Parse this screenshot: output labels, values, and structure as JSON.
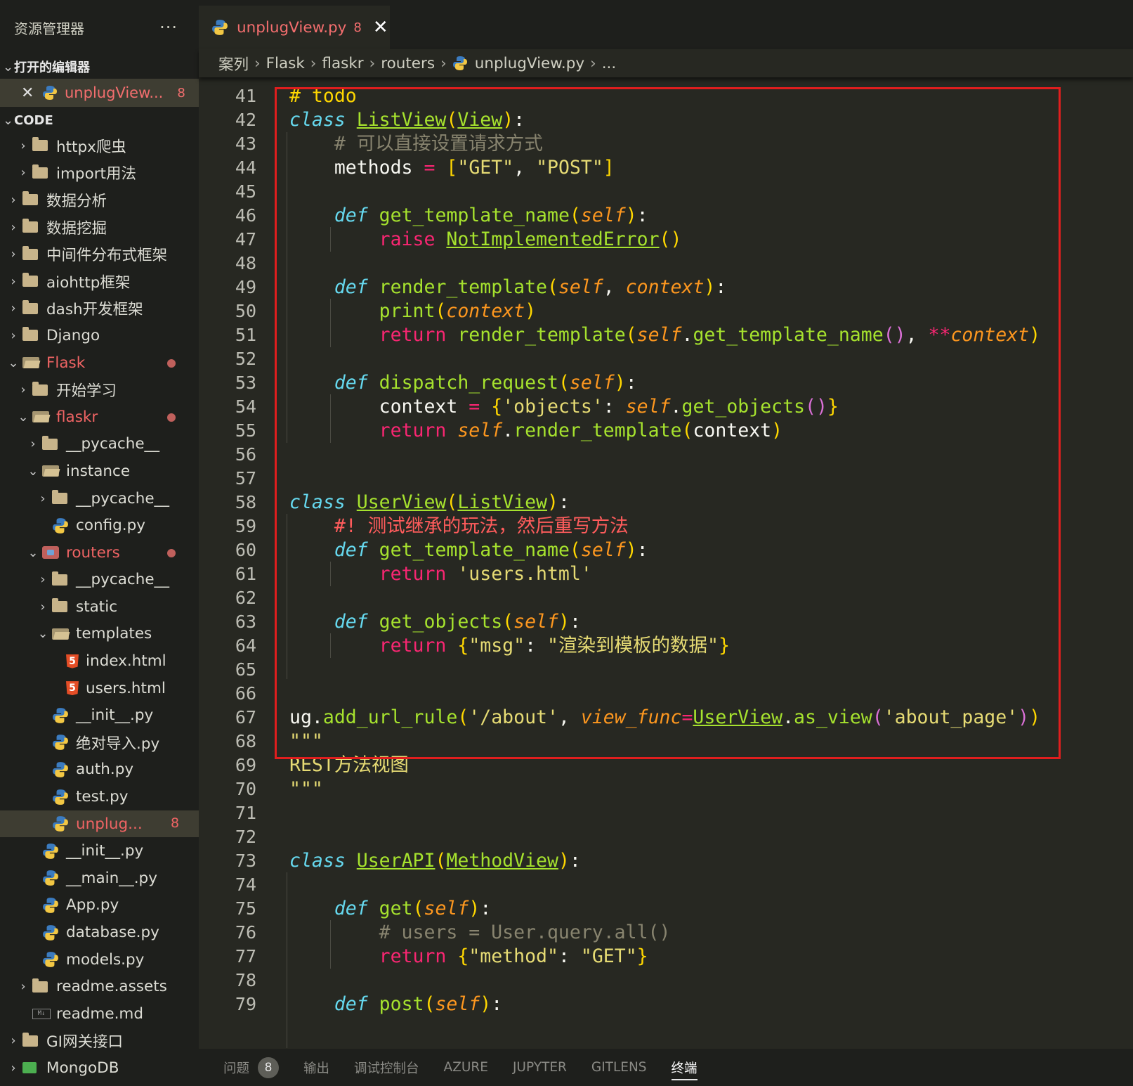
{
  "colors": {
    "accent_error": "#f36e6e",
    "editor_bg": "#272822",
    "sidebar_bg": "#1e1f1c",
    "highlight_border": "#e01e1e"
  },
  "sidebar": {
    "title": "资源管理器",
    "more": "···",
    "open_editors_label": "打开的编辑器",
    "open_editor": {
      "name": "unplugView...",
      "problems": "8"
    },
    "workspace_label": "CODE",
    "tree": [
      {
        "label": "httpx爬虫",
        "icon": "folder-icon",
        "chev": "›"
      },
      {
        "label": "import用法",
        "icon": "folder-icon",
        "chev": "›"
      },
      {
        "label": "数据分析",
        "icon": "folder-icon",
        "chev": "›"
      },
      {
        "label": "数据挖掘",
        "icon": "folder-icon",
        "chev": "›"
      },
      {
        "label": "中间件分布式框架",
        "icon": "folder-icon",
        "chev": "›"
      },
      {
        "label": "aiohttp框架",
        "icon": "folder-icon",
        "chev": "›"
      },
      {
        "label": "dash开发框架",
        "icon": "folder-icon",
        "chev": "›"
      },
      {
        "label": "Django",
        "icon": "folder-icon",
        "chev": "›"
      },
      {
        "label": "Flask",
        "icon": "folder-open-icon",
        "chev": "⌄"
      },
      {
        "label": "开始学习",
        "icon": "folder-icon",
        "chev": "›"
      },
      {
        "label": "flaskr",
        "icon": "folder-open-icon",
        "chev": "⌄"
      },
      {
        "label": "__pycache__",
        "icon": "folder-icon",
        "chev": "›"
      },
      {
        "label": "instance",
        "icon": "folder-open-icon",
        "chev": "⌄"
      },
      {
        "label": "__pycache__",
        "icon": "folder-icon",
        "chev": "›"
      },
      {
        "label": "config.py",
        "icon": "python-icon",
        "chev": ""
      },
      {
        "label": "routers",
        "icon": "routers-folder-icon",
        "chev": "⌄"
      },
      {
        "label": "__pycache__",
        "icon": "folder-icon",
        "chev": "›"
      },
      {
        "label": "static",
        "icon": "folder-icon",
        "chev": "›"
      },
      {
        "label": "templates",
        "icon": "folder-open-icon",
        "chev": "⌄"
      },
      {
        "label": "index.html",
        "icon": "html-icon",
        "chev": ""
      },
      {
        "label": "users.html",
        "icon": "html-icon",
        "chev": ""
      },
      {
        "label": "__init__.py",
        "icon": "python-icon",
        "chev": ""
      },
      {
        "label": "绝对导入.py",
        "icon": "python-icon",
        "chev": ""
      },
      {
        "label": "auth.py",
        "icon": "python-icon",
        "chev": ""
      },
      {
        "label": "test.py",
        "icon": "python-icon",
        "chev": ""
      },
      {
        "label": "unplug...",
        "icon": "python-icon",
        "chev": "",
        "count": "8"
      },
      {
        "label": "__init__.py",
        "icon": "python-icon",
        "chev": ""
      },
      {
        "label": "__main__.py",
        "icon": "python-icon",
        "chev": ""
      },
      {
        "label": "App.py",
        "icon": "python-icon",
        "chev": ""
      },
      {
        "label": "database.py",
        "icon": "python-icon",
        "chev": ""
      },
      {
        "label": "models.py",
        "icon": "python-icon",
        "chev": ""
      },
      {
        "label": "readme.assets",
        "icon": "folder-icon",
        "chev": "›"
      },
      {
        "label": "readme.md",
        "icon": "markdown-icon",
        "chev": ""
      },
      {
        "label": "GI网关接口",
        "icon": "folder-icon",
        "chev": "›"
      },
      {
        "label": "MongoDB",
        "icon": "mongodb-folder-icon",
        "chev": "›"
      }
    ]
  },
  "tab": {
    "name": "unplugView.py",
    "problems": "8",
    "close": "✕"
  },
  "breadcrumb": [
    "案列",
    "Flask",
    "flaskr",
    "routers",
    "unplugView.py",
    "..."
  ],
  "editor": {
    "line_numbers": [
      "41",
      "42",
      "43",
      "44",
      "45",
      "46",
      "47",
      "48",
      "49",
      "50",
      "51",
      "52",
      "53",
      "54",
      "55",
      "56",
      "57",
      "58",
      "59",
      "60",
      "61",
      "62",
      "63",
      "64",
      "65",
      "66",
      "67",
      "68",
      "69",
      "70",
      "71",
      "72",
      "73",
      "74",
      "75",
      "76",
      "77",
      "78",
      "79"
    ],
    "strings": {
      "todo": "# todo",
      "cm43": "# 可以直接设置请求方式",
      "get": "\"GET\"",
      "post": "\"POST\"",
      "cm59": "#! 测试继承的玩法，然后重写方法",
      "users_html": "'users.html'",
      "msg_key": "\"msg\"",
      "msg_val": "\"渲染到模板的数据\"",
      "about": "'/about'",
      "about_page": "'about_page'",
      "objects": "'objects'",
      "docstring": "REST方法视图",
      "cm76": "# users = User.query.all()",
      "method_key": "\"method\""
    }
  },
  "panel": {
    "tabs": [
      {
        "label": "问题",
        "badge": "8"
      },
      {
        "label": "输出"
      },
      {
        "label": "调试控制台"
      },
      {
        "label": "AZURE"
      },
      {
        "label": "JUPYTER"
      },
      {
        "label": "GITLENS"
      },
      {
        "label": "终端",
        "active": true
      }
    ]
  }
}
